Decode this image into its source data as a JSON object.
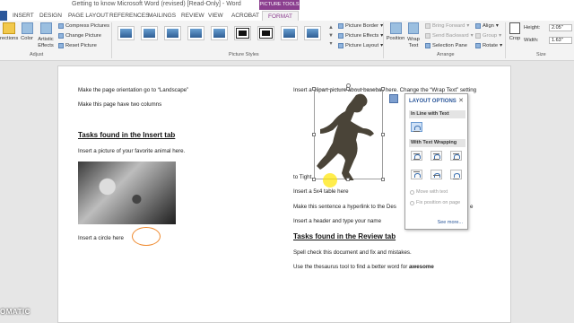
{
  "window": {
    "title": "Getting to know Microsoft Word (revised) [Read-Only] - Word",
    "context_group": "PICTURE TOOLS"
  },
  "tabs": [
    "FILE",
    "INSERT",
    "DESIGN",
    "PAGE LAYOUT",
    "REFERENCES",
    "MAILINGS",
    "REVIEW",
    "VIEW",
    "ACROBAT",
    "FORMAT"
  ],
  "ribbon": {
    "adjust": {
      "corrections": "rections",
      "color": "Color",
      "artistic": "Artistic Effects",
      "compress": "Compress Pictures",
      "change": "Change Picture",
      "reset": "Reset Picture",
      "label": "Adjust"
    },
    "styles": {
      "label": "Picture Styles"
    },
    "style_side": {
      "border": "Picture Border",
      "effects": "Picture Effects",
      "layout": "Picture Layout"
    },
    "arrange": {
      "position": "Position",
      "wrap": "Wrap Text",
      "bring": "Bring Forward",
      "send": "Send Backward",
      "selection": "Selection Pane",
      "align": "Align",
      "group": "Group",
      "rotate": "Rotate",
      "label": "Arrange"
    },
    "size": {
      "crop": "Crop",
      "height_label": "Height:",
      "height_value": "2.05\"",
      "width_label": "Width:",
      "width_value": "1.63\"",
      "label": "Size"
    }
  },
  "document": {
    "left": {
      "l1": "Make the page orientation go to “Landscape”",
      "l2": "Make this page have two columns",
      "heading": "Tasks found in the Insert tab",
      "l3": "Insert a picture of your favorite animal here.",
      "l4": "Insert a circle here"
    },
    "right": {
      "r1": "Insert a clipart picture about baseball here. Change the “Wrap Text” setting",
      "r2": "to Tight.",
      "r3": "Insert a 5x4 table here",
      "r4": "Make this sentence a hyperlink to the Des",
      "r4b": "e",
      "r5": "Insert a header and type your name",
      "heading": "Tasks found in the Review tab",
      "r6": "Spell check this document and fix and mistakes.",
      "r7_prefix": "Use the thesaurus tool to find a better word for ",
      "r7_bold": "awesome"
    }
  },
  "layout_options": {
    "title": "LAYOUT OPTIONS",
    "inline": "In Line with Text",
    "wrapping": "With Text Wrapping",
    "move": "Move with text",
    "fix": "Fix position on page",
    "more": "See more..."
  },
  "watermark": "OMATIC"
}
